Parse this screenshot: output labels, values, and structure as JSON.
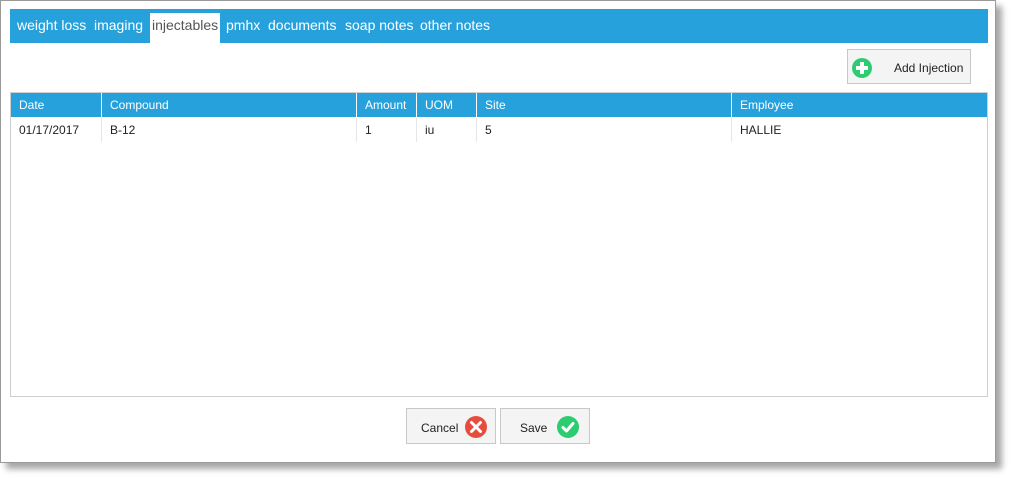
{
  "tabs": [
    {
      "label": "weight loss"
    },
    {
      "label": "imaging"
    },
    {
      "label": "injectables"
    },
    {
      "label": "pmhx"
    },
    {
      "label": "documents"
    },
    {
      "label": "soap notes"
    },
    {
      "label": "other notes"
    }
  ],
  "active_tab": "injectables",
  "toolbar": {
    "add_label": "Add Injection"
  },
  "table": {
    "columns": [
      "Date",
      "Compound",
      "Amount",
      "UOM",
      "Site",
      "Employee"
    ],
    "rows": [
      [
        "01/17/2017",
        "B-12",
        "1",
        "iu",
        "5",
        "HALLIE"
      ]
    ]
  },
  "footer": {
    "cancel_label": "Cancel",
    "save_label": "Save"
  },
  "colors": {
    "accent": "#27a1dc",
    "add_icon": "#2ecc71",
    "cancel_icon": "#e74c3c",
    "save_icon": "#2ecc71"
  },
  "icons": {
    "add": "plus-circle-icon",
    "cancel": "x-circle-icon",
    "save": "check-circle-icon"
  }
}
